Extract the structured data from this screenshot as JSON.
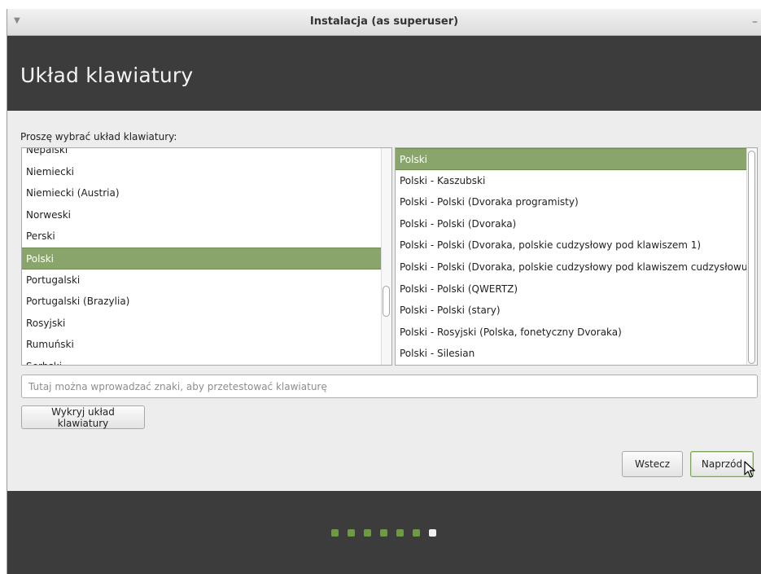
{
  "window": {
    "title": "Instalacja (as superuser)",
    "menu_icon": "triangle-down-icon",
    "minimize_icon": "minimize-icon"
  },
  "header": {
    "title": "Układ klawiatury"
  },
  "prompt": "Proszę wybrać układ klawiatury:",
  "layouts": {
    "items": [
      "Nepalski",
      "Niemiecki",
      "Niemiecki (Austria)",
      "Norweski",
      "Perski",
      "Polski",
      "Portugalski",
      "Portugalski (Brazylia)",
      "Rosyjski",
      "Rumuński",
      "Serbski"
    ],
    "selected": "Polski"
  },
  "variants": {
    "items": [
      "Polski",
      "Polski - Kaszubski",
      "Polski - Polski (Dvoraka programisty)",
      "Polski - Polski (Dvoraka)",
      "Polski - Polski (Dvoraka, polskie cudzysłowy pod klawiszem 1)",
      "Polski - Polski (Dvoraka, polskie cudzysłowy pod klawiszem cudzysłowu)",
      "Polski - Polski (QWERTZ)",
      "Polski - Polski (stary)",
      "Polski - Rosyjski (Polska, fonetyczny Dvoraka)",
      "Polski - Silesian"
    ],
    "selected": "Polski"
  },
  "test_input": {
    "value": "",
    "placeholder": "Tutaj można wprowadzać znaki, aby przetestować klawiaturę"
  },
  "buttons": {
    "detect": "Wykryj układ klawiatury",
    "back": "Wstecz",
    "next": "Naprzód"
  },
  "progress": {
    "total_steps": 7,
    "current_step": 7
  },
  "colors": {
    "header_bg": "#3c3c3c",
    "selection": "#8aa56b",
    "progress_done": "#6f9a44",
    "progress_current": "#f0f0f0"
  }
}
